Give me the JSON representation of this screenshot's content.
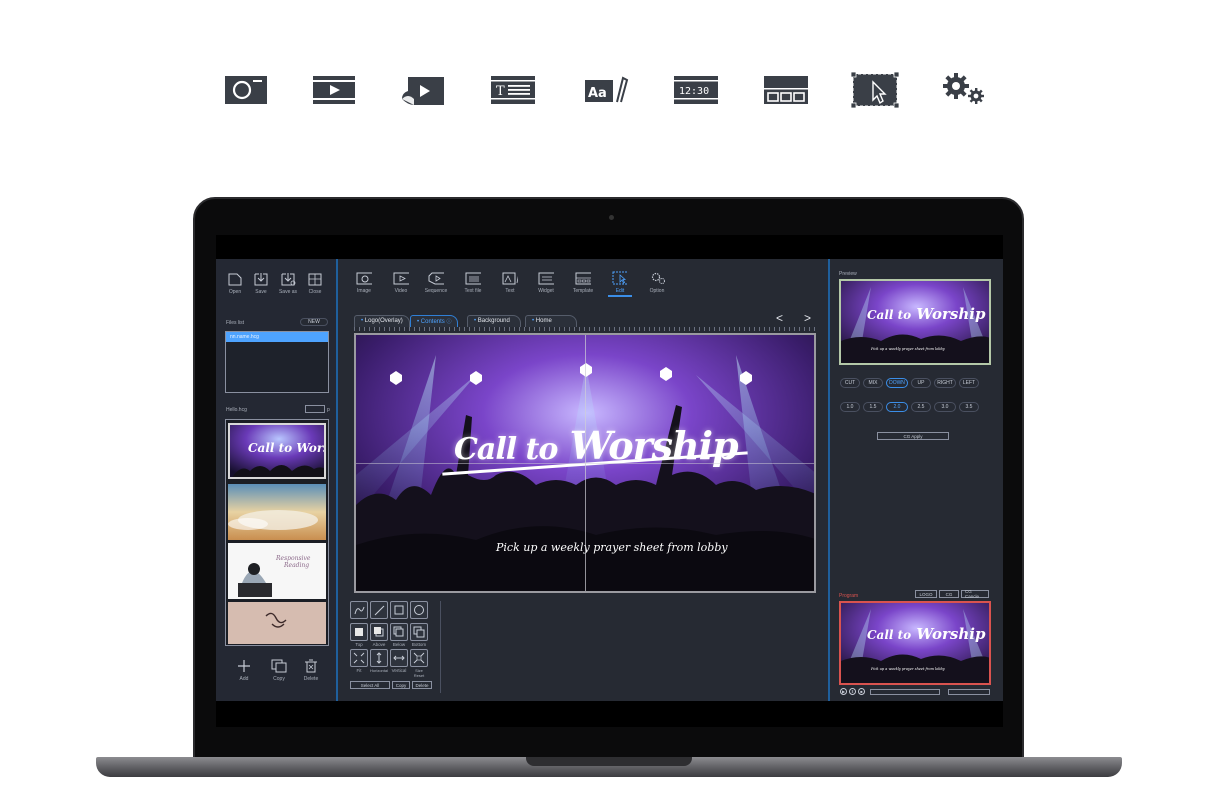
{
  "feature_icons": [
    "camera-icon",
    "video-icon",
    "sequence-icon",
    "text-file-icon",
    "text-icon",
    "widget-clock-icon",
    "template-icon",
    "edit-select-icon",
    "option-gears-icon"
  ],
  "widget_clock_text": "12:30",
  "text_icon_label": "Aa",
  "toolbar_left": {
    "open": "Open",
    "save": "Save",
    "save_as": "Save as",
    "close": "Close"
  },
  "files_list": {
    "label": "Files list",
    "new_button": "NEW",
    "selected_file": "nn.name.hcg"
  },
  "project": {
    "file_label": "Hello.hcg",
    "page_indicator": "p"
  },
  "left_bottom": {
    "add": "Add",
    "copy": "Copy",
    "delete": "Delete"
  },
  "toolbar_main": {
    "image": "Image",
    "video": "Video",
    "sequence": "Sequence",
    "text_file": "Text file",
    "text": "Text",
    "widget": "Widget",
    "template": "Template",
    "edit": "Edit",
    "option": "Option"
  },
  "tabs": [
    {
      "label": "Logo(Overlay)"
    },
    {
      "label": "Contents"
    },
    {
      "label": "Background"
    },
    {
      "label": "Home"
    }
  ],
  "nav": {
    "prev": "<",
    "next": ">"
  },
  "slide": {
    "title_a": "Call to",
    "title_b": "Worship",
    "subtitle": "Pick up a weekly prayer sheet from lobby"
  },
  "thumb3": {
    "line1": "Responsive",
    "line2": "Reading"
  },
  "edit_tools": {
    "order": [
      "Top",
      "Above",
      "Below",
      "Bottom"
    ],
    "fit": [
      "Fit",
      "Horizontal",
      "Vertical",
      "Size Reset"
    ],
    "select_all": "Select All",
    "copy": "Copy",
    "delete": "Delete"
  },
  "right": {
    "preview_label": "Preview",
    "transitions": [
      "CUT",
      "MIX",
      "DOWN",
      "UP",
      "RIGHT",
      "LEFT"
    ],
    "active_transition": "DOWN",
    "speeds": [
      "1.0",
      "1.5",
      "2.0",
      "2.5",
      "3.0",
      "3.5"
    ],
    "active_speed": "2.0",
    "cg_apply": "CG Apply",
    "program_label": "Program",
    "program_buttons": [
      "LOGO",
      "CG",
      "CG Cancle"
    ]
  },
  "colors": {
    "accent": "#3b8ee8",
    "panel": "#262a33",
    "program_label": "#d9534f"
  }
}
